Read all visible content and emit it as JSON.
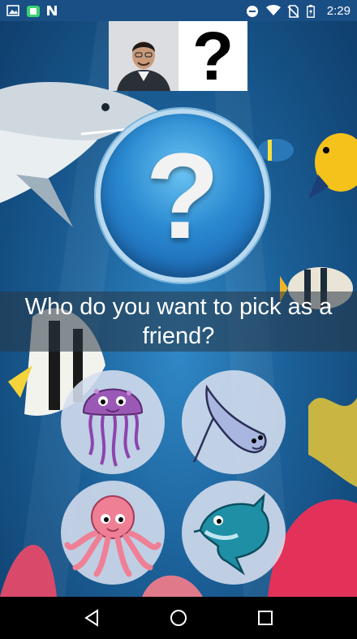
{
  "status_bar": {
    "time": "2:29",
    "left_icons": [
      "image-icon",
      "app-notification-icon",
      "n-app-icon"
    ],
    "right_icons": [
      "do-not-disturb-icon",
      "wifi-icon",
      "no-sim-icon",
      "battery-charging-icon"
    ]
  },
  "video_strip": {
    "caller_video": "caller-camera-feed",
    "unknown_symbol": "?"
  },
  "question_button": {
    "symbol": "?"
  },
  "prompt": {
    "text": "Who do you want to pick as a friend?"
  },
  "choices": [
    {
      "name": "jellyfish",
      "color": "#9b59b6"
    },
    {
      "name": "manta-ray",
      "color": "#a9b6e0"
    },
    {
      "name": "octopus",
      "color": "#ef7f95"
    },
    {
      "name": "dolphin",
      "color": "#1f8fa6"
    }
  ],
  "nav_bar": {
    "buttons": [
      "back-icon",
      "home-icon",
      "recents-icon"
    ]
  },
  "colors": {
    "status_bar": "#1a4f86",
    "ocean": "#1b5f97",
    "accent_blue": "#2a89d0"
  }
}
